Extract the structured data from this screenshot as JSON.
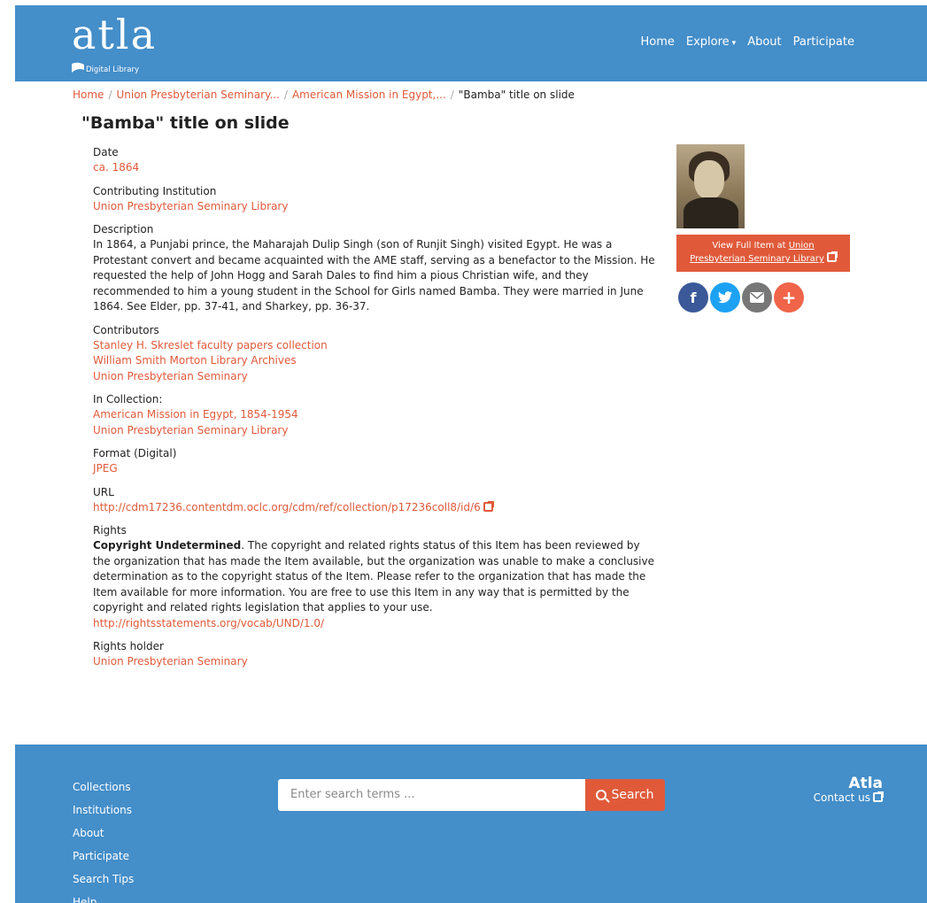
{
  "header": {
    "logo_text": "atla",
    "logo_subtext": "Digital Library",
    "nav": [
      "Home",
      "Explore",
      "About",
      "Participate"
    ]
  },
  "breadcrumb": {
    "items": [
      "Home",
      "Union Presbyterian Seminary...",
      "American Mission in Egypt,..."
    ],
    "current": "\"Bamba\" title on slide"
  },
  "item": {
    "title": "\"Bamba\" title on slide",
    "fields": {
      "date": {
        "label": "Date",
        "value": "ca. 1864"
      },
      "contributing_institution": {
        "label": "Contributing Institution",
        "value": "Union Presbyterian Seminary Library"
      },
      "description": {
        "label": "Description",
        "value": "In 1864, a Punjabi prince, the Maharajah Dulip Singh (son of Runjit Singh) visited Egypt. He was a Protestant convert and became acquainted with the AME staff, serving as a benefactor to the Mission. He requested the help of John Hogg and Sarah Dales to find him a pious Christian wife, and they recommended to him a young student in the School for Girls named Bamba. They were married in June 1864. See Elder, pp. 37-41, and Sharkey, pp. 36-37."
      },
      "contributors": {
        "label": "Contributors",
        "values": [
          "Stanley H. Skreslet faculty papers collection",
          "William Smith Morton Library Archives",
          "Union Presbyterian Seminary"
        ]
      },
      "in_collection": {
        "label": "In Collection:",
        "values": [
          "American Mission in Egypt, 1854-1954",
          "Union Presbyterian Seminary Library"
        ]
      },
      "format": {
        "label": "Format (Digital)",
        "value": "JPEG"
      },
      "url": {
        "label": "URL",
        "value": "http://cdm17236.contentdm.oclc.org/cdm/ref/collection/p17236coll8/id/6"
      },
      "rights": {
        "label": "Rights",
        "strong": "Copyright Undetermined",
        "text": ". The copyright and related rights status of this Item has been reviewed by the organization that has made the Item available, but the organization was unable to make a conclusive determination as to the copyright status of the Item. Please refer to the organization that has made the Item available for more information. You are free to use this Item in any way that is permitted by the copyright and related rights legislation that applies to your use. ",
        "link": "http://rightsstatements.org/vocab/UND/1.0/"
      },
      "rights_holder": {
        "label": "Rights holder",
        "value": "Union Presbyterian Seminary"
      }
    }
  },
  "sidebar": {
    "view_prefix": "View Full Item at ",
    "view_line1_link": "Union",
    "view_line2_link": "Presbyterian Seminary Library",
    "social": {
      "facebook": {
        "glyph": "f",
        "color": "#3b5998"
      },
      "twitter": {
        "glyph": "t",
        "color": "#1da1f2"
      },
      "email": {
        "glyph": "✉",
        "color": "#777777"
      },
      "more": {
        "glyph": "+",
        "color": "#f06449"
      }
    }
  },
  "footer": {
    "links": [
      "Collections",
      "Institutions",
      "About",
      "Participate",
      "Search Tips",
      "Help"
    ],
    "search_placeholder": "Enter search terms ...",
    "search_button": "Search",
    "brand": "Atla",
    "contact": "Contact us"
  },
  "colors": {
    "header_bg": "#448ec9",
    "accent": "#e05a3a"
  }
}
